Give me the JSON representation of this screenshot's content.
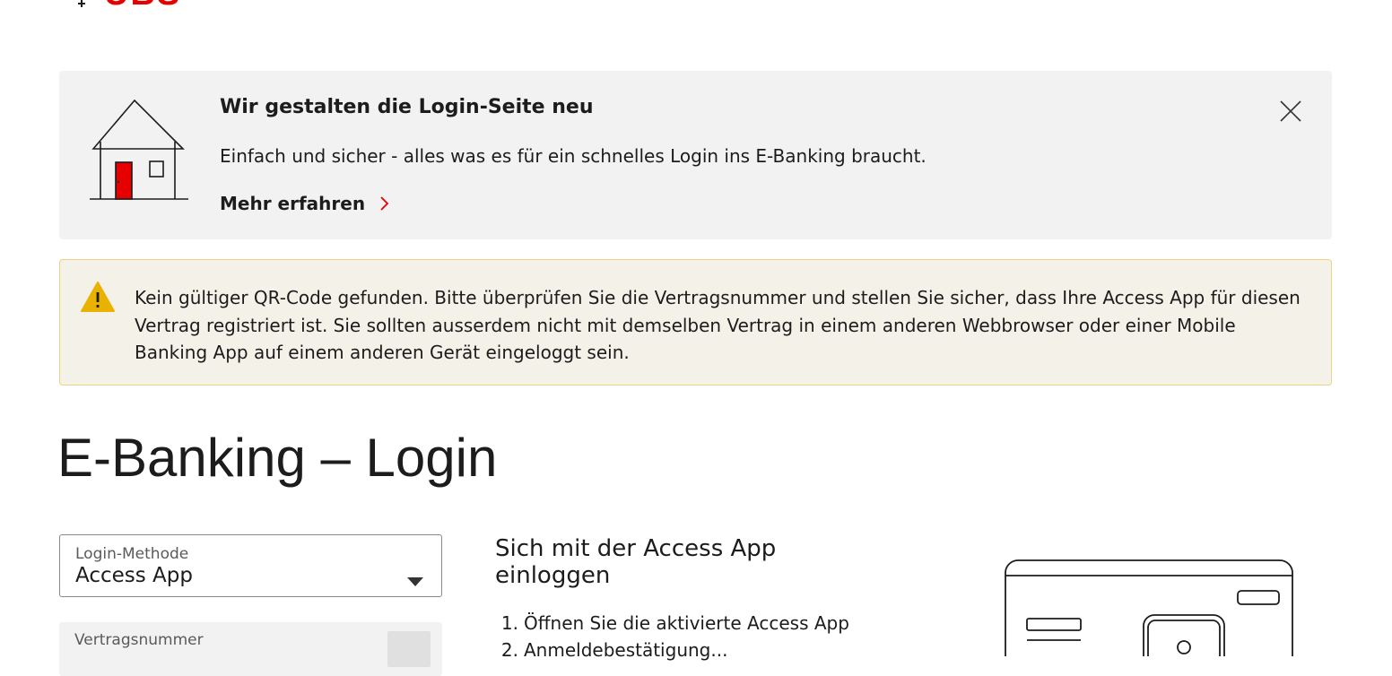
{
  "header": {
    "logo_text": "UBS",
    "logo_icon": "keys-icon"
  },
  "info_banner": {
    "icon": "house-icon",
    "title": "Wir gestalten die Login-Seite neu",
    "text": "Einfach und sicher - alles was es für ein schnelles Login ins E-Banking braucht.",
    "link_label": "Mehr erfahren",
    "link_icon": "chevron-right-icon",
    "close_icon": "close-icon",
    "link_icon_color": "#e60000"
  },
  "warning": {
    "icon": "warning-icon",
    "icon_color": "#e9b100",
    "text": "Kein gültiger QR-Code gefunden. Bitte überprüfen Sie die Vertragsnummer und stellen Sie sicher, dass Ihre Access App für diesen Vertrag registriert ist. Sie sollten ausserdem nicht mit demselben Vertrag in einem anderen Webbrowser oder einer Mobile Banking App auf einem anderen Gerät eingeloggt sein."
  },
  "page": {
    "title": "E-Banking – Login"
  },
  "form": {
    "login_method": {
      "label": "Login-Methode",
      "value": "Access App"
    },
    "contract_number": {
      "label": "Vertragsnummer"
    }
  },
  "instructions": {
    "title": "Sich mit der Access App einloggen",
    "steps": [
      {
        "num": "1.",
        "text": "Öffnen Sie die aktivierte Access App"
      },
      {
        "num": "2.",
        "text": "Anmeldebestätigung..."
      }
    ]
  },
  "colors": {
    "brand_red": "#e60000",
    "warning_border": "#f0d082",
    "warning_bg": "#f4f1e9",
    "info_bg": "#f2f2f2"
  }
}
